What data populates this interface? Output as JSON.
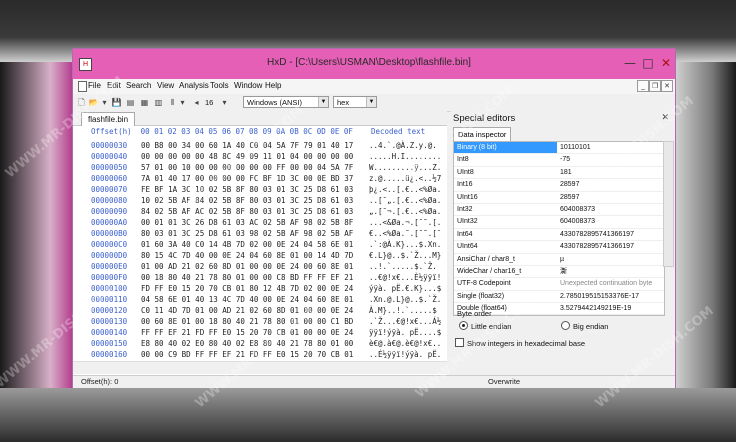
{
  "window": {
    "title": "HxD - [C:\\Users\\USMAN\\Desktop\\flashfile.bin]",
    "minimize": "—",
    "maximize": "□",
    "close": "✕"
  },
  "menu": [
    "File",
    "Edit",
    "Search",
    "View",
    "Analysis",
    "Tools",
    "Window",
    "Help"
  ],
  "toolbar": {
    "bytes_per_row": "16",
    "charset": "Windows (ANSI)",
    "offset_base": "hex"
  },
  "tab": "flashfile.bin",
  "hex_header": "Offset(h)  00 01 02 03 04 05 06 07 08 09 0A 0B 0C 0D 0E 0F    Decoded text",
  "rows": [
    {
      "off": "00000030",
      "hex": "00 B8 00 34 00 60 1A 40 C0 04 5A 7F 79 01 40 17",
      "dec": "..4.`.@À.Z.y.@."
    },
    {
      "off": "00000040",
      "hex": "00 00 00 00 00 48 8C 49 09 11 01 04 00 00 00 00",
      "dec": ".....H.I........"
    },
    {
      "off": "00000050",
      "hex": "57 01 00 10 00 00 00 00 00 00 FF 00 00 04 5A 7F",
      "dec": "W.........ÿ...Z."
    },
    {
      "off": "00000060",
      "hex": "7A 01 40 17 00 00 00 00 FC BF 1D 3C 00 0E BD 37",
      "dec": "z.@.....ü¿.<..½7"
    },
    {
      "off": "00000070",
      "hex": "FE BF 1A 3C 10 02 5B 8F 80 03 01 3C 25 D8 61 03",
      "dec": "þ¿.<..[.€..<%Øa."
    },
    {
      "off": "00000080",
      "hex": "10 02 5B AF 84 02 5B 8F 80 03 01 3C 25 D8 61 03",
      "dec": "..[¯„.[.€..<%Øa."
    },
    {
      "off": "00000090",
      "hex": "84 02 5B AF AC 02 5B 8F 80 03 01 3C 25 D8 61 03",
      "dec": "„.[¯¬.[.€..<%Øa."
    },
    {
      "off": "000000A0",
      "hex": "00 01 01 3C 26 D8 61 03 AC 02 5B AF 98 02 5B 8F",
      "dec": "...<&Øa.¬.[¯˜.[."
    },
    {
      "off": "000000B0",
      "hex": "80 03 01 3C 25 D8 61 03 98 02 5B AF 98 02 5B AF",
      "dec": "€..<%Øa.˜.[¯˜.[¯"
    },
    {
      "off": "000000C0",
      "hex": "01 60 3A 40 C0 14 4B 7D 02 00 0E 24 04 58 6E 01",
      "dec": ".`:@À.K}...$.Xn."
    },
    {
      "off": "000000D0",
      "hex": "80 15 4C 7D 40 00 0E 24 04 60 8E 01 00 14 4D 7D",
      "dec": "€.L}@..$.`Ž...M}"
    },
    {
      "off": "000000E0",
      "hex": "01 00 AD 21 02 60 8D 01 00 00 0E 24 00 60 8E 01",
      "dec": "..­!.`.....$.`Ž."
    },
    {
      "off": "000000F0",
      "hex": "00 18 80 40 21 78 80 01 00 00 C8 BD FF FF EF 21",
      "dec": "..€@!x€...È½ÿÿï!"
    },
    {
      "off": "00000100",
      "hex": "FD FF E0 15 20 70 CB 01 80 12 4B 7D 02 00 0E 24",
      "dec": "ýÿà. pË.€.K}...$"
    },
    {
      "off": "00000110",
      "hex": "04 58 6E 01 40 13 4C 7D 40 00 0E 24 04 60 8E 01",
      "dec": ".Xn.@.L}@..$.`Ž."
    },
    {
      "off": "00000120",
      "hex": "C0 11 4D 7D 01 00 AD 21 02 60 8D 01 00 00 0E 24",
      "dec": "À.M}..­!.`.....$"
    },
    {
      "off": "00000130",
      "hex": "00 60 8E 01 00 18 80 40 21 78 80 01 00 00 C1 BD",
      "dec": ".`Ž...€@!x€...Á½"
    },
    {
      "off": "00000140",
      "hex": "FF FF EF 21 FD FF E0 15 20 70 CB 01 00 00 0E 24",
      "dec": "ÿÿï!ýÿà. pË....$"
    },
    {
      "off": "00000150",
      "hex": "E8 80 40 02 E0 80 40 02 E8 80 40 21 78 80 01 00",
      "dec": "è€@.à€@.è€@!x€.."
    },
    {
      "off": "00000160",
      "hex": "00 00 C9 BD FF FF EF 21 FD FF E0 15 20 70 CB 01",
      "dec": "..É½ÿÿï!ýÿà. pË."
    },
    {
      "off": "00000170",
      "hex": "06 80 80 14 00 00 00 00 00 80 1A 40 F8 FF 01 24",
      "dec": ".€€......€.@øÿ.$"
    }
  ],
  "status_offset": "Offset(h): 0",
  "status_mode": "Overwrite",
  "special_editors": {
    "title": "Special editors",
    "close": "✕",
    "tab": "Data inspector",
    "fields": [
      {
        "k": "Binary (8 bit)",
        "v": "10110101"
      },
      {
        "k": "Int8",
        "v": "-75"
      },
      {
        "k": "UInt8",
        "v": "181"
      },
      {
        "k": "Int16",
        "v": "28597"
      },
      {
        "k": "UInt16",
        "v": "28597"
      },
      {
        "k": "Int32",
        "v": "604008373"
      },
      {
        "k": "UInt32",
        "v": "604008373"
      },
      {
        "k": "Int64",
        "v": "4330782895741366197"
      },
      {
        "k": "UInt64",
        "v": "4330782895741366197"
      },
      {
        "k": "AnsiChar / char8_t",
        "v": "µ"
      },
      {
        "k": "WideChar / char16_t",
        "v": "澵"
      },
      {
        "k": "UTF-8 Codepoint",
        "v": "Unexpected continuation byte"
      },
      {
        "k": "Single (float32)",
        "v": "2.785019515153376E-17"
      },
      {
        "k": "Double (float64)",
        "v": "3.5279442149219E-19"
      }
    ],
    "byte_order_label": "Byte order",
    "little_endian": "Little endian",
    "big_endian": "Big endian",
    "hex_ints": "Show integers in hexadecimal base"
  },
  "watermark": "WWW.MR-DISH.COM",
  "colors": {
    "titlebar": "#e45fb5",
    "offset_blue": "#3a5fcd",
    "selection": "#3399ff"
  }
}
